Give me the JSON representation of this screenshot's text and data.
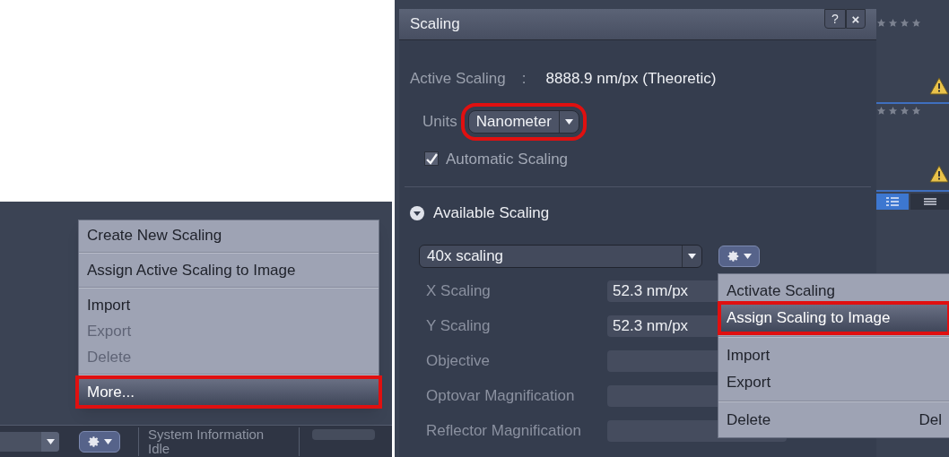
{
  "left_panel": {
    "menu": [
      {
        "kind": "item",
        "label": "Create New Scaling",
        "disabled": false,
        "selected": false,
        "highlighted": false
      },
      {
        "kind": "separator"
      },
      {
        "kind": "item",
        "label": "Assign Active Scaling to Image",
        "disabled": false,
        "selected": false,
        "highlighted": false
      },
      {
        "kind": "separator"
      },
      {
        "kind": "item",
        "label": "Import",
        "disabled": false,
        "selected": false,
        "highlighted": false
      },
      {
        "kind": "item",
        "label": "Export",
        "disabled": true,
        "selected": false,
        "highlighted": false
      },
      {
        "kind": "item",
        "label": "Delete",
        "disabled": true,
        "selected": false,
        "highlighted": false
      },
      {
        "kind": "separator"
      },
      {
        "kind": "item",
        "label": "More...",
        "disabled": false,
        "selected": true,
        "highlighted": true
      }
    ],
    "status": {
      "title": "System Information",
      "state": "Idle"
    }
  },
  "dialog": {
    "title": "Scaling",
    "help": "?",
    "close": "×",
    "active_scaling": {
      "label": "Active Scaling",
      "separator": ":",
      "value": "8888.9 nm/px (Theoretic)"
    },
    "units": {
      "label": "Units",
      "value": "Nanometer",
      "highlighted": true
    },
    "automatic_scaling": {
      "label": "Automatic Scaling",
      "checked": true
    },
    "available_scaling": {
      "label": "Available Scaling",
      "expanded": true,
      "selection": "40x scaling"
    },
    "fields": [
      {
        "label": "X Scaling",
        "value": "52.3 nm/px"
      },
      {
        "label": "Y Scaling",
        "value": "52.3 nm/px"
      },
      {
        "label": "Objective"
      },
      {
        "label": "Optovar Magnification"
      },
      {
        "label": "Reflector Magnification"
      }
    ],
    "menu": [
      {
        "kind": "item",
        "label": "Activate Scaling",
        "selected": false,
        "highlighted": false
      },
      {
        "kind": "item",
        "label": "Assign Scaling to Image",
        "selected": true,
        "highlighted": true
      },
      {
        "kind": "separator"
      },
      {
        "kind": "item",
        "label": "Import",
        "selected": false,
        "highlighted": false
      },
      {
        "kind": "item",
        "label": "Export",
        "selected": false,
        "highlighted": false
      },
      {
        "kind": "separator"
      },
      {
        "kind": "item",
        "label": "Delete",
        "shortcut": "Del",
        "selected": false,
        "highlighted": false
      }
    ]
  },
  "thumbnails": [
    {
      "stars": 0
    },
    {
      "stars": 0
    }
  ]
}
